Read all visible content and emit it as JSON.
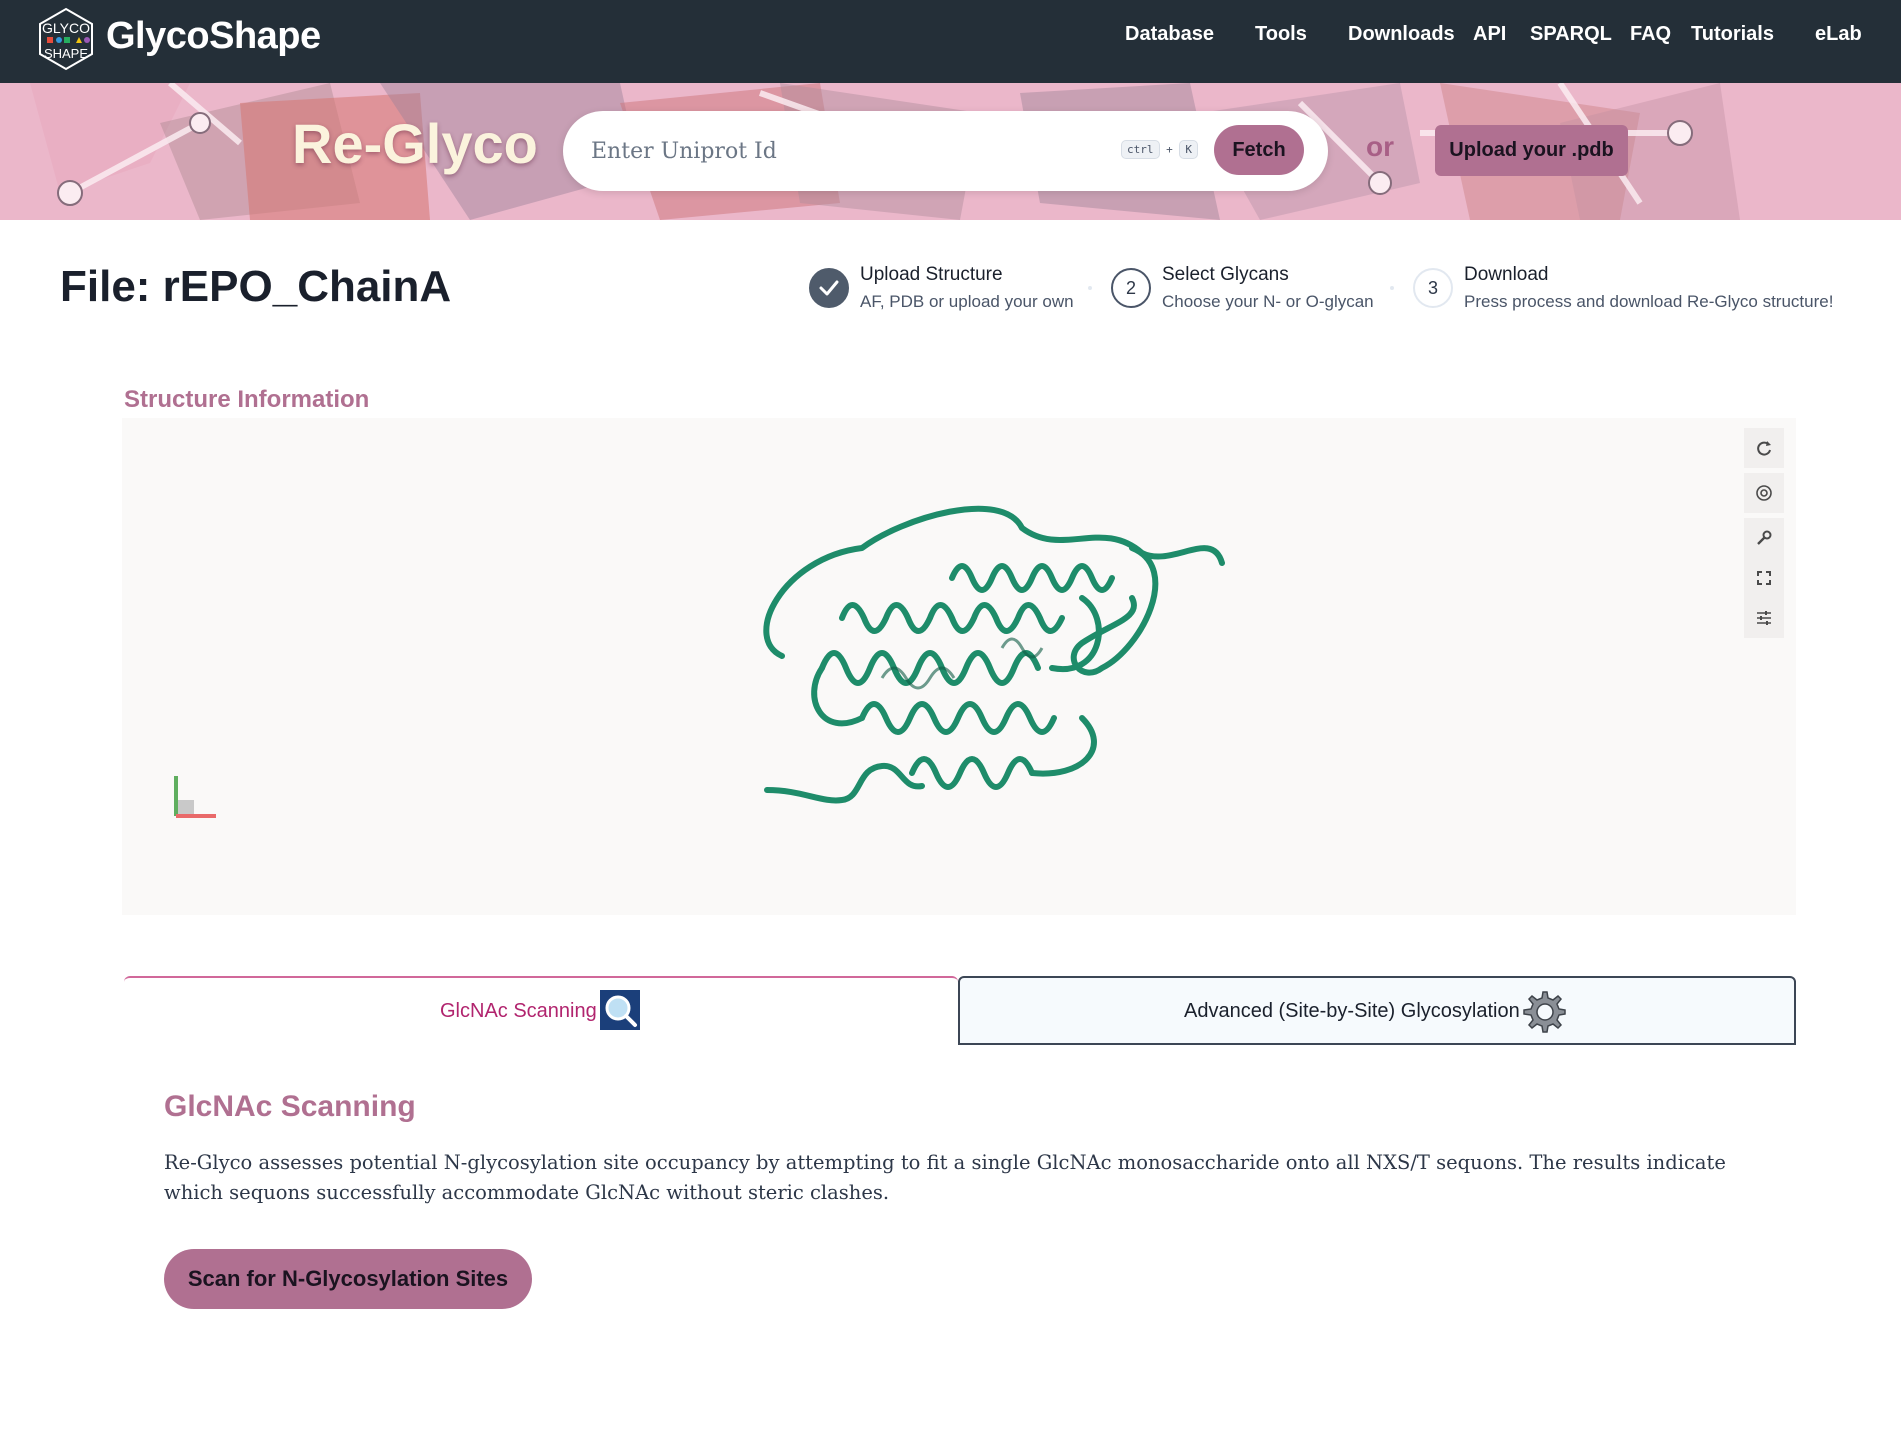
{
  "header": {
    "brand": "GlycoShape",
    "logo_text_top": "GLYCO",
    "logo_text_bottom": "SHAPE",
    "nav": [
      {
        "label": "Database"
      },
      {
        "label": "Tools"
      },
      {
        "label": "Downloads"
      },
      {
        "label": "API"
      },
      {
        "label": "SPARQL"
      },
      {
        "label": "FAQ"
      },
      {
        "label": "Tutorials"
      },
      {
        "label": "eLab"
      }
    ]
  },
  "hero": {
    "title": "Re-Glyco",
    "search": {
      "placeholder": "Enter Uniprot Id",
      "value": "",
      "kbd_ctrl": "ctrl",
      "kbd_plus": "+",
      "kbd_key": "K"
    },
    "fetch_label": "Fetch",
    "or_label": "or",
    "upload_label": "Upload your .pdb"
  },
  "file": {
    "title": "File: rEPO_ChainA"
  },
  "steps": [
    {
      "number": "",
      "title": "Upload Structure",
      "desc": "AF, PDB or upload your own",
      "status": "complete"
    },
    {
      "number": "2",
      "title": "Select Glycans",
      "desc": "Choose your N- or O-glycan",
      "status": "active"
    },
    {
      "number": "3",
      "title": "Download",
      "desc": "Press process and download Re-Glyco structure!",
      "status": "pending"
    }
  ],
  "structure": {
    "section_label": "Structure Information",
    "toolbar": [
      "reset-icon",
      "screenshot-icon",
      "wrench-icon",
      "expand-icon",
      "settings-sliders-icon"
    ],
    "colors": {
      "protein": "#1e8c6a",
      "axis_x": "#e96a6a",
      "axis_y": "#5fae5f"
    }
  },
  "tabs": [
    {
      "label": "GlcNAc Scanning",
      "active": true,
      "icon": "magnifier-icon"
    },
    {
      "label": "Advanced (Site-by-Site) Glycosylation",
      "active": false,
      "icon": "gear-icon"
    }
  ],
  "panel": {
    "heading": "GlcNAc Scanning",
    "description": "Re-Glyco assesses potential N-glycosylation site occupancy by attempting to fit a single GlcNAc monosaccharide onto all NXS/T sequons. The results indicate which sequons successfully accommodate GlcNAc without steric clashes.",
    "scan_button": "Scan for N-Glycosylation Sites"
  },
  "colors": {
    "nav_bg": "#242f38",
    "accent": "#b07091",
    "accent_tab": "#b1246e",
    "hero_bg": "#e7aec4"
  }
}
